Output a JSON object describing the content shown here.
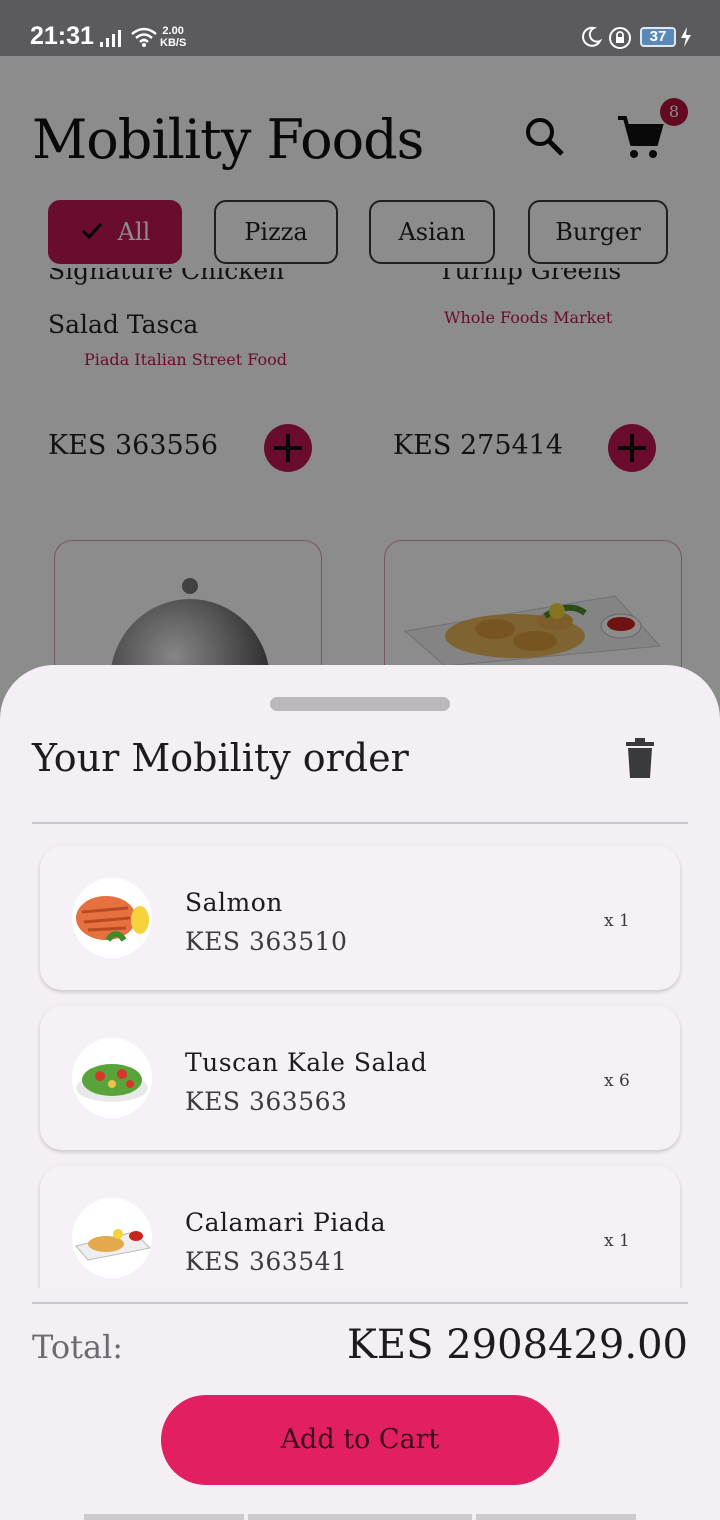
{
  "status_bar": {
    "time": "21:31",
    "net_speed_value": "2.00",
    "net_speed_unit": "KB/S",
    "battery": "37"
  },
  "app": {
    "title": "Mobility Foods",
    "cart_count": "8",
    "categories": [
      {
        "label": "All",
        "selected": true
      },
      {
        "label": "Pizza",
        "selected": false
      },
      {
        "label": "Asian",
        "selected": false
      },
      {
        "label": "Burger",
        "selected": false
      }
    ],
    "items": [
      {
        "name_line1": "Signature Chicken",
        "name_line2": "Salad Tasca",
        "restaurant": "Piada Italian Street Food",
        "price": "KES 363556"
      },
      {
        "name_line1": "Turnip Greens",
        "restaurant": "Whole Foods Market",
        "price": "KES 275414"
      }
    ]
  },
  "sheet": {
    "title": "Your Mobility order",
    "order_items": [
      {
        "name": "Salmon",
        "price": "KES 363510",
        "qty": "x 1"
      },
      {
        "name": "Tuscan Kale Salad",
        "price": "KES 363563",
        "qty": "x 6"
      },
      {
        "name": "Calamari Piada",
        "price": "KES 363541",
        "qty": "x 1"
      }
    ],
    "total_label": "Total:",
    "total_value": "KES 2908429.00",
    "add_button": "Add to Cart"
  },
  "colors": {
    "accent": "#c21655",
    "button": "#e11f61",
    "sheet_bg": "#f4eff5"
  }
}
